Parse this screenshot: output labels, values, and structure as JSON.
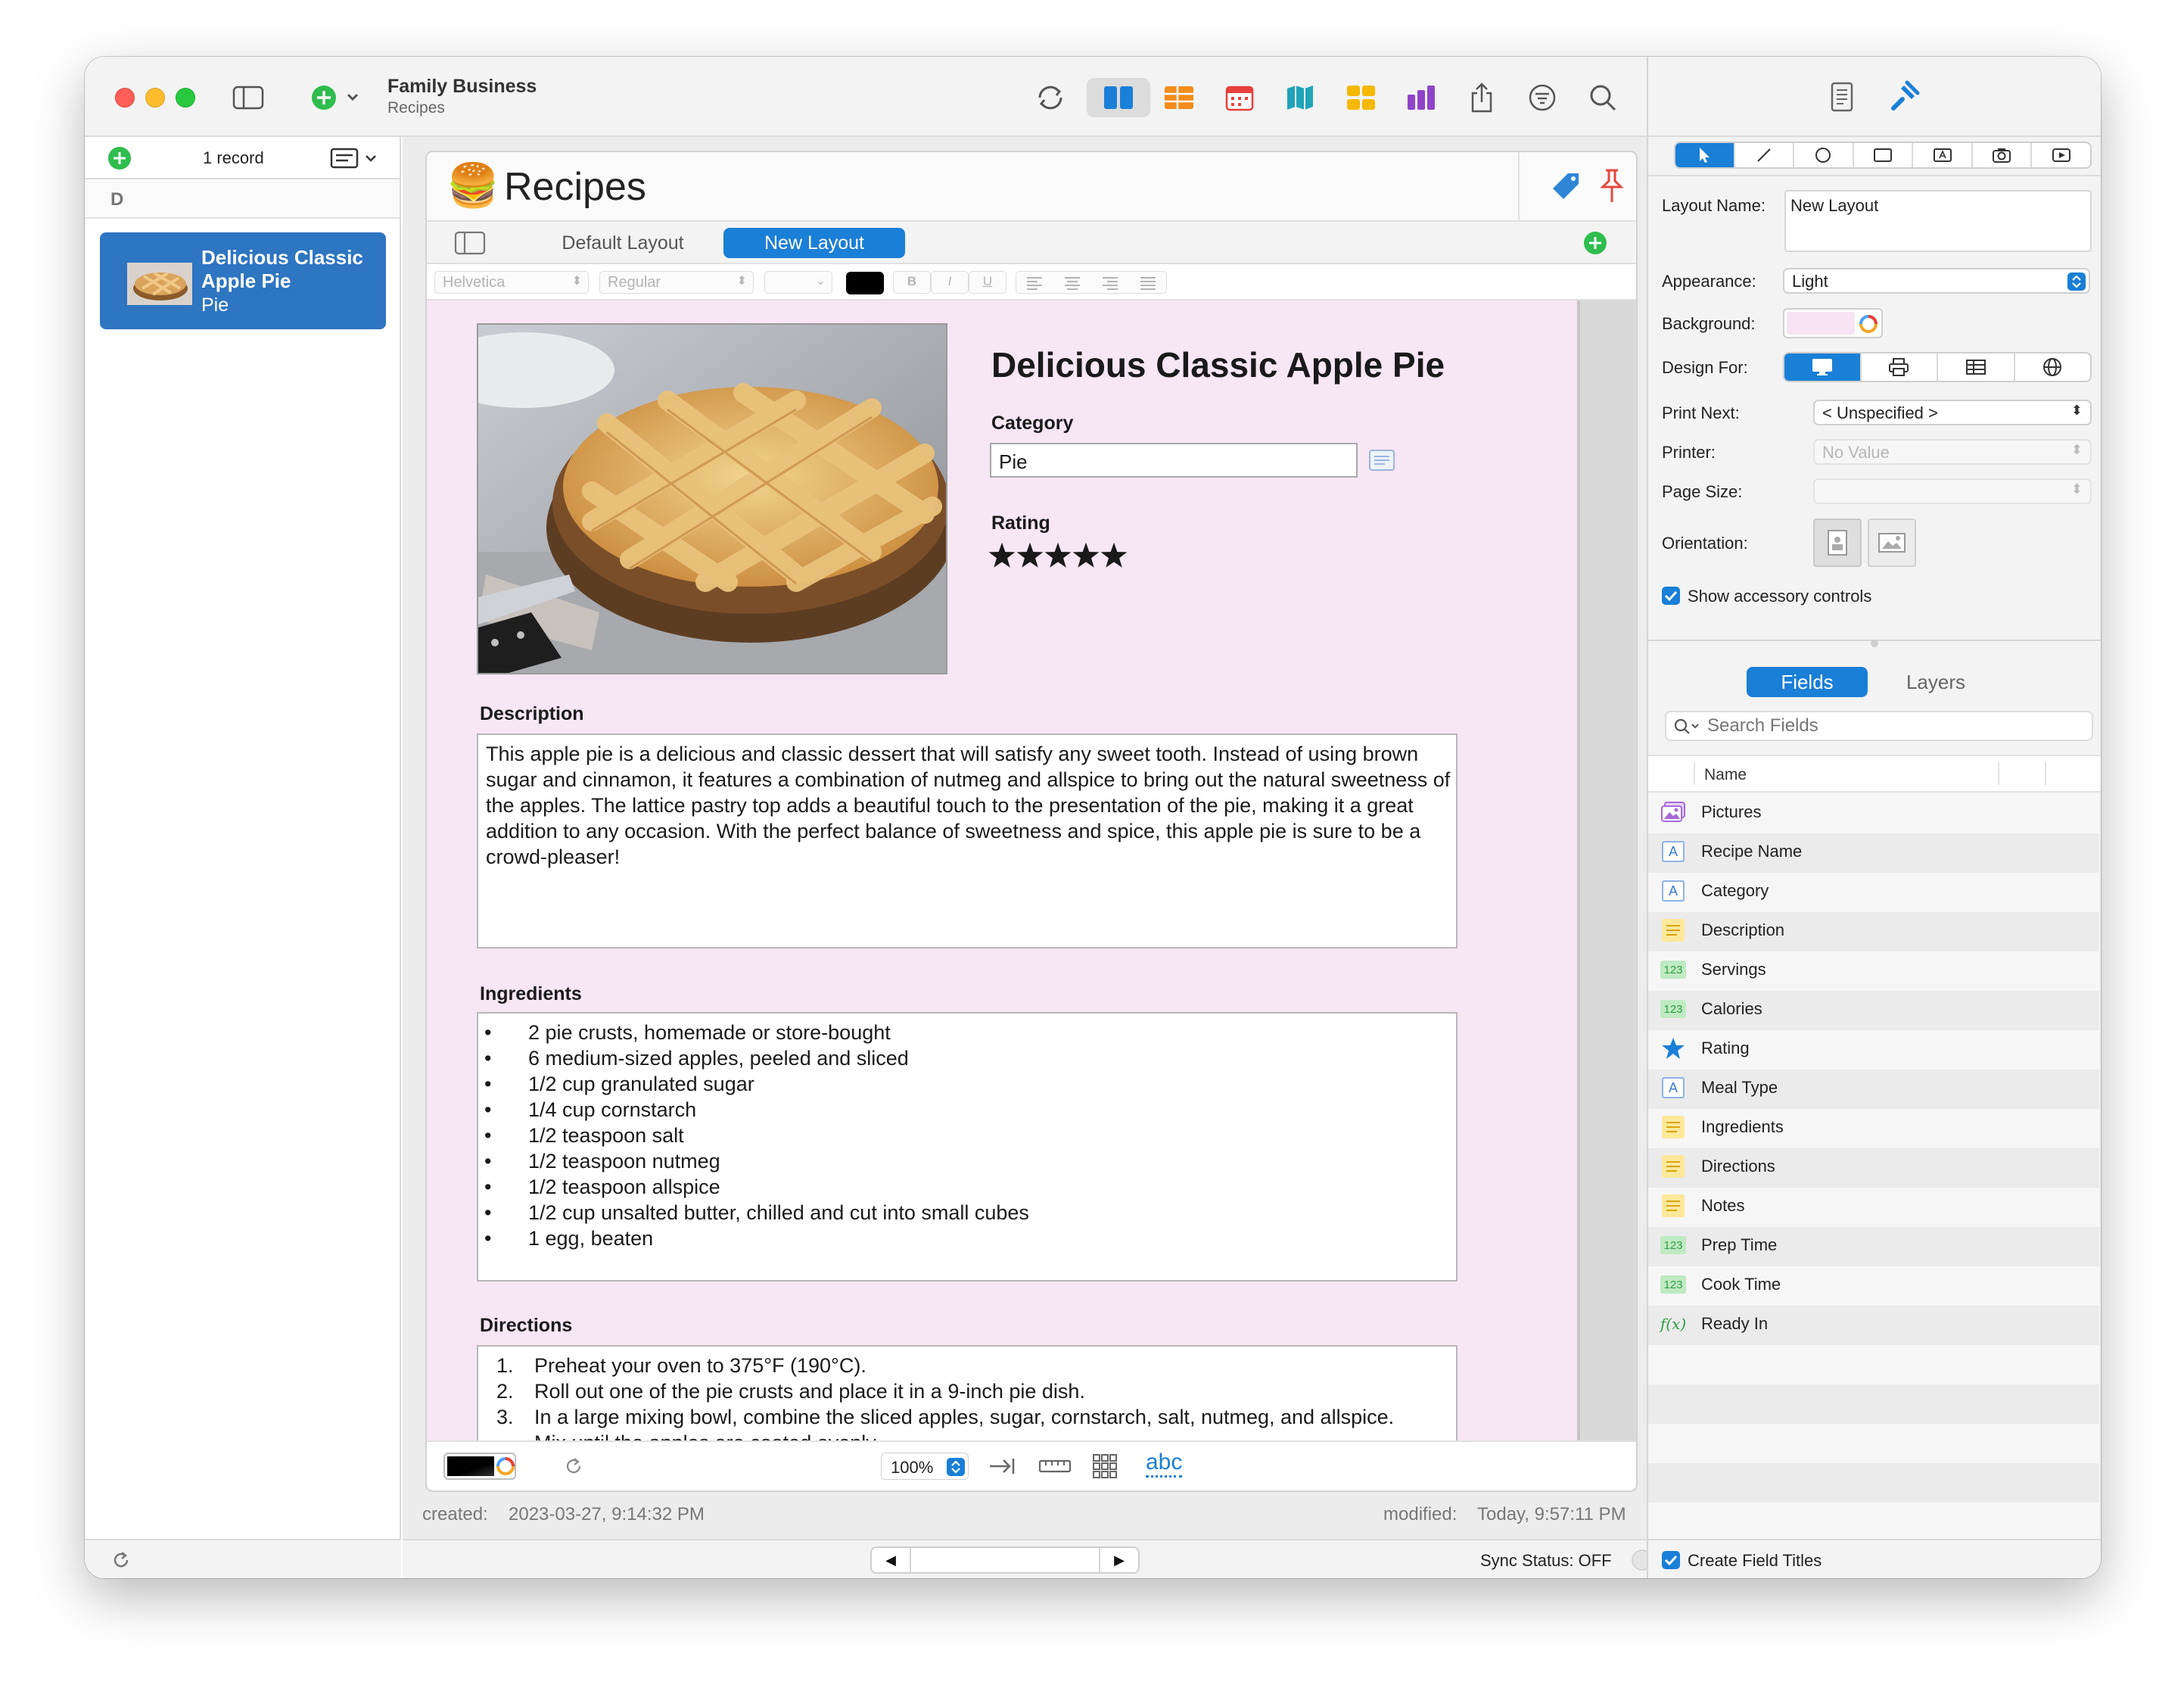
{
  "window": {
    "title": "Family Business",
    "subtitle": "Recipes"
  },
  "sidebar": {
    "record_count": "1 record",
    "section_letter": "D",
    "records": [
      {
        "title": "Delicious Classic Apple Pie",
        "subtitle": "Pie"
      }
    ]
  },
  "form": {
    "name": "Recipes",
    "emoji": "🍔",
    "tabs": [
      {
        "label": "Default Layout",
        "active": false
      },
      {
        "label": "New Layout",
        "active": true
      }
    ],
    "format_bar": {
      "font": "Helvetica",
      "style": "Regular",
      "bold": "B",
      "italic": "I",
      "underline": "U"
    }
  },
  "record": {
    "recipe_name": "Delicious Classic Apple Pie",
    "category_label": "Category",
    "category_value": "Pie",
    "rating_label": "Rating",
    "rating": 5,
    "rating_max": 5,
    "description_label": "Description",
    "description": "This apple pie is a delicious and classic dessert that will satisfy any sweet tooth. Instead of using brown sugar and cinnamon, it features a combination of nutmeg and allspice to bring out the natural sweetness of the apples. The lattice pastry top adds a beautiful touch to the presentation of the pie, making it a great addition to any occasion. With the perfect balance of sweetness and spice, this apple pie is sure to be a crowd-pleaser!",
    "ingredients_label": "Ingredients",
    "ingredients": [
      "2 pie crusts, homemade or store-bought",
      "6 medium-sized apples, peeled and sliced",
      "1/2 cup granulated sugar",
      "1/4 cup cornstarch",
      "1/2 teaspoon salt",
      "1/2 teaspoon nutmeg",
      "1/2 teaspoon allspice",
      "1/2 cup unsalted butter, chilled and cut into small cubes",
      "1 egg, beaten"
    ],
    "directions_label": "Directions",
    "directions": [
      "Preheat your oven to 375°F (190°C).",
      "Roll out one of the pie crusts and place it in a 9-inch pie dish.",
      "In a large mixing bowl, combine the sliced apples, sugar, cornstarch, salt, nutmeg, and allspice.",
      "Mix until the apples are coated evenly."
    ]
  },
  "bottom_toolbar": {
    "zoom": "100%",
    "spell": "abc"
  },
  "footer": {
    "created_label": "created:",
    "created_value": "2023-03-27, 9:14:32 PM",
    "modified_label": "modified:",
    "modified_value": "Today, 9:57:11 PM",
    "sync_status": "Sync Status: OFF"
  },
  "inspector": {
    "layout_name_label": "Layout Name:",
    "layout_name_value": "New Layout",
    "appearance_label": "Appearance:",
    "appearance_value": "Light",
    "background_label": "Background:",
    "background_color": "#f6e3f3",
    "design_for_label": "Design For:",
    "print_next_label": "Print Next:",
    "print_next_value": "< Unspecified >",
    "printer_label": "Printer:",
    "printer_value": "No Value",
    "page_size_label": "Page Size:",
    "orientation_label": "Orientation:",
    "show_accessory_label": "Show accessory controls",
    "tabs": [
      {
        "label": "Fields",
        "active": true
      },
      {
        "label": "Layers",
        "active": false
      }
    ],
    "search_placeholder": "Search Fields",
    "column_name": "Name",
    "fields": [
      {
        "name": "Pictures",
        "icon": "pictures-icon"
      },
      {
        "name": "Recipe Name",
        "icon": "text-field-icon"
      },
      {
        "name": "Category",
        "icon": "text-field-icon"
      },
      {
        "name": "Description",
        "icon": "note-field-icon"
      },
      {
        "name": "Servings",
        "icon": "number-field-icon"
      },
      {
        "name": "Calories",
        "icon": "number-field-icon"
      },
      {
        "name": "Rating",
        "icon": "star-icon"
      },
      {
        "name": "Meal Type",
        "icon": "text-field-icon"
      },
      {
        "name": "Ingredients",
        "icon": "note-field-icon"
      },
      {
        "name": "Directions",
        "icon": "note-field-icon"
      },
      {
        "name": "Notes",
        "icon": "note-field-icon"
      },
      {
        "name": "Prep Time",
        "icon": "number-field-icon"
      },
      {
        "name": "Cook Time",
        "icon": "number-field-icon"
      },
      {
        "name": "Ready In",
        "icon": "formula-field-icon"
      }
    ],
    "create_field_titles_label": "Create Field Titles"
  },
  "colors": {
    "accent": "#1a7fd6",
    "selection": "#2e75c2",
    "add_green": "#2ebd4e",
    "layout_bg": "#f7e6f3"
  }
}
